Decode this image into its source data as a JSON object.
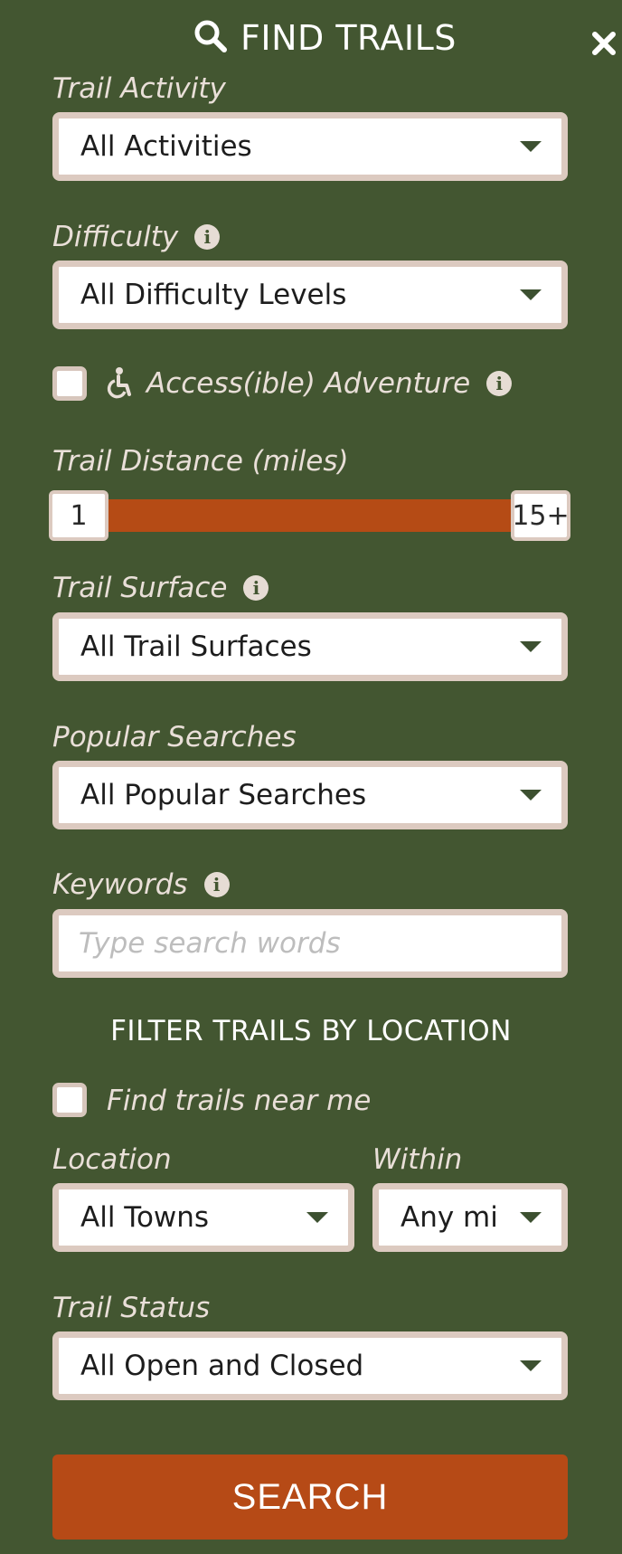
{
  "header": {
    "title": "FIND TRAILS"
  },
  "trail_activity": {
    "label": "Trail Activity",
    "selected": "All Activities"
  },
  "difficulty": {
    "label": "Difficulty",
    "selected": "All Difficulty Levels"
  },
  "accessible": {
    "label": "Access(ible) Adventure",
    "checked": false
  },
  "distance": {
    "label": "Trail Distance (miles)",
    "min_label": "1",
    "max_label": "15+"
  },
  "trail_surface": {
    "label": "Trail Surface",
    "selected": "All Trail Surfaces"
  },
  "popular": {
    "label": "Popular Searches",
    "selected": "All Popular Searches"
  },
  "keywords": {
    "label": "Keywords",
    "placeholder": "Type search words"
  },
  "location_section": {
    "title": "FILTER TRAILS BY LOCATION",
    "near_me_label": "Find trails near me",
    "near_me_checked": false
  },
  "location": {
    "label": "Location",
    "selected": "All Towns"
  },
  "within": {
    "label": "Within",
    "selected": "Any mi"
  },
  "trail_status": {
    "label": "Trail Status",
    "selected": "All Open and Closed"
  },
  "search_button": {
    "label": "SEARCH"
  },
  "colors": {
    "background": "#435631",
    "accent": "#b54b15",
    "field_border": "#dccac0"
  }
}
